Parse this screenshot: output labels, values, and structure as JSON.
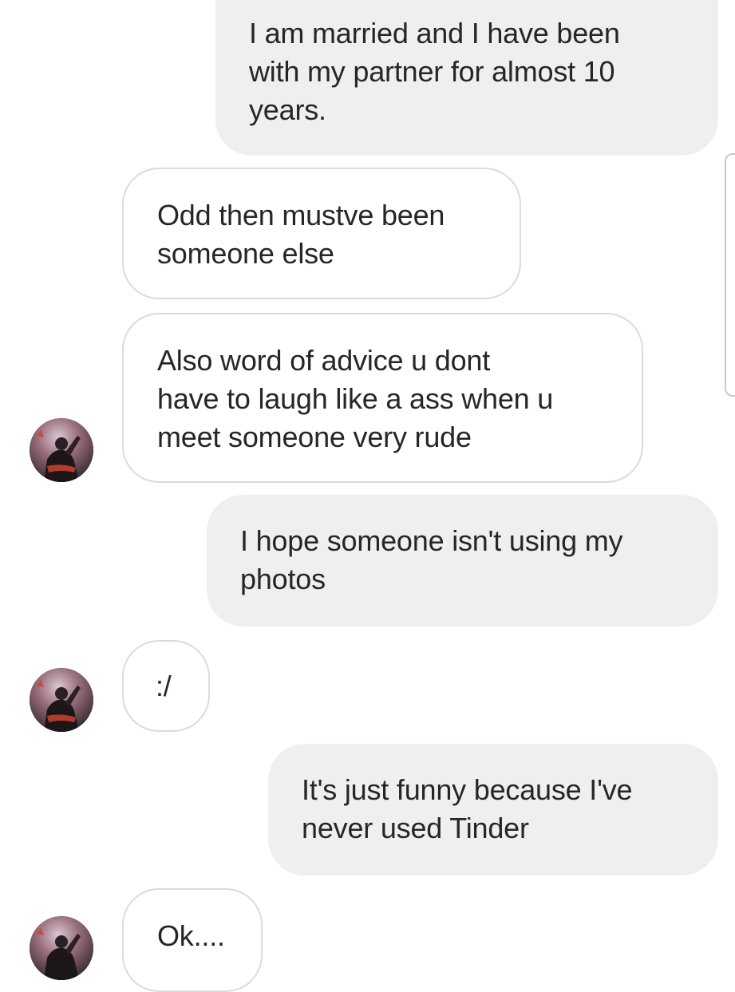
{
  "conversation": {
    "messages": [
      {
        "direction": "sent",
        "text": "I am married and I have been\nwith my partner for almost 10\nyears."
      },
      {
        "direction": "received",
        "text": "Odd then mustve been\nsomeone else"
      },
      {
        "direction": "received",
        "text": "Also word of advice u dont\nhave to laugh like a ass when u\nmeet someone very rude"
      },
      {
        "direction": "sent",
        "text": "I hope someone isn't using my\nphotos"
      },
      {
        "direction": "received",
        "text": ":/"
      },
      {
        "direction": "sent",
        "text": "It's just funny because I've\nnever used Tinder"
      },
      {
        "direction": "received",
        "text": "Ok...."
      }
    ]
  },
  "colors": {
    "sent_bubble": "#efefef",
    "received_border": "#dbdbdb",
    "text": "#262626"
  },
  "icons": {
    "avatar": "contact-avatar-photo"
  }
}
